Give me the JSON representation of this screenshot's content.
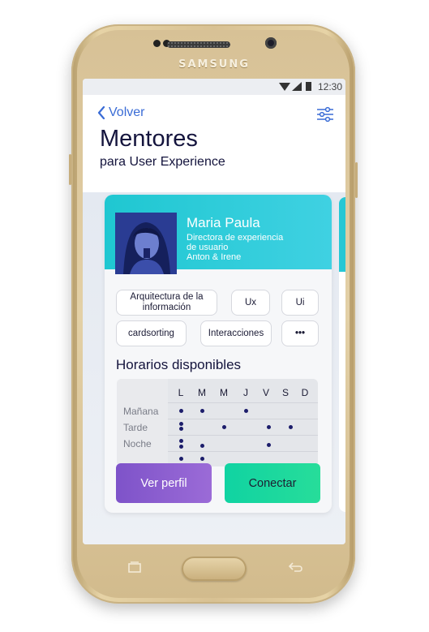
{
  "device": {
    "brand": "SAMSUNG"
  },
  "status_bar": {
    "time": "12:30",
    "icons": [
      "wifi-icon",
      "signal-icon",
      "battery-icon"
    ]
  },
  "header": {
    "back_label": "Volver",
    "title": "Mentores",
    "subtitle": "para User Experience"
  },
  "mentor": {
    "name": "Maria Paula",
    "role_line1": "Directora de experiencia",
    "role_line2": "de usuario",
    "company": "Anton & Irene",
    "tags": [
      "Arquitectura de la información",
      "Ux",
      "Ui",
      "cardsorting",
      "Interacciones",
      "•••"
    ],
    "schedule_title": "Horarios disponibles",
    "days": [
      "L",
      "M",
      "M",
      "J",
      "V",
      "S",
      "D"
    ],
    "slots": [
      "Mañana",
      "Tarde",
      "Noche"
    ],
    "buttons": {
      "profile": "Ver perfil",
      "connect": "Conectar"
    }
  },
  "colors": {
    "accent_blue": "#3a6cd6",
    "card_header": "#1fc7d1",
    "profile_button": "#8a5ed0",
    "connect_button": "#18d89e",
    "dot": "#1c1d6b"
  }
}
